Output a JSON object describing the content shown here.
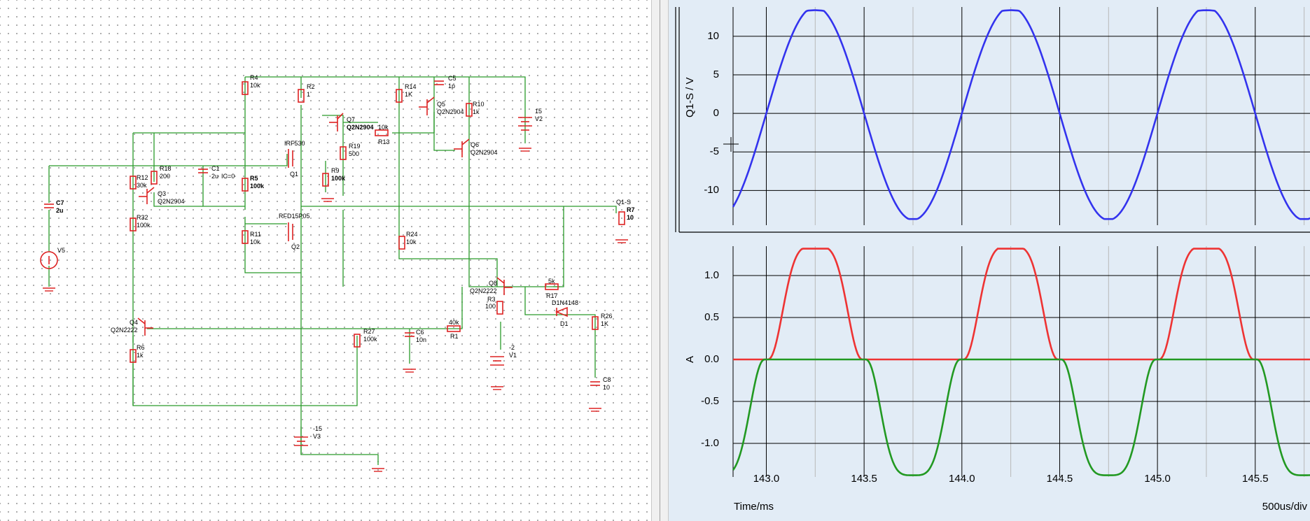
{
  "schematic": {
    "components": {
      "r4": {
        "ref": "R4",
        "value": "10k"
      },
      "r2": {
        "ref": "R2",
        "value": "1"
      },
      "r14": {
        "ref": "R14",
        "value": "1K"
      },
      "c5": {
        "ref": "C5",
        "value": "1p"
      },
      "r10": {
        "ref": "R10",
        "value": "1k"
      },
      "v2": {
        "ref": "V2",
        "value": "15"
      },
      "q7": {
        "ref": "Q7",
        "model": "Q2N2904"
      },
      "q5": {
        "ref": "Q5",
        "model": "Q2N2904"
      },
      "q6": {
        "ref": "Q6",
        "model": "Q2N2904"
      },
      "r13": {
        "ref": "R13",
        "value": "10k"
      },
      "r19": {
        "ref": "R19",
        "value": "500"
      },
      "r9": {
        "ref": "R9",
        "value": "100k"
      },
      "q1": {
        "ref": "Q1",
        "model": "IRF530"
      },
      "r18": {
        "ref": "R18",
        "value": "200"
      },
      "c1": {
        "ref": "C1",
        "value": "2u",
        "ic": "IC=0"
      },
      "r5": {
        "ref": "R5",
        "value": "100k"
      },
      "r12": {
        "ref": "R12",
        "value": "30k"
      },
      "q3": {
        "ref": "Q3",
        "model": "Q2N2904"
      },
      "c7": {
        "ref": "C7",
        "value": "2u"
      },
      "r32": {
        "ref": "R32",
        "value": "100k"
      },
      "q2": {
        "ref": "Q2",
        "model": "RFD15P05"
      },
      "r11": {
        "ref": "R11",
        "value": "10k"
      },
      "v5": {
        "ref": "V5"
      },
      "r24": {
        "ref": "R24",
        "value": "10k"
      },
      "r7": {
        "ref": "R7",
        "value": "10"
      },
      "probe": {
        "label": "Q1-S"
      },
      "q8": {
        "ref": "Q8",
        "model": "Q2N2222"
      },
      "r3": {
        "ref": "R3",
        "value": "100"
      },
      "r17": {
        "ref": "R17",
        "value": "5k"
      },
      "d1": {
        "ref": "D1",
        "model": "D1N4148"
      },
      "r26": {
        "ref": "R26",
        "value": "1K"
      },
      "c8": {
        "ref": "C8",
        "value": "10"
      },
      "q4": {
        "ref": "Q4",
        "model": "Q2N2222"
      },
      "r6": {
        "ref": "R6",
        "value": "1k"
      },
      "r27": {
        "ref": "R27",
        "value": "100k"
      },
      "c6": {
        "ref": "C6",
        "value": "10n"
      },
      "r1": {
        "ref": "R1",
        "value": "40k"
      },
      "v1": {
        "ref": "V1",
        "value": "-2"
      },
      "v3": {
        "ref": "V3",
        "value": "-15"
      }
    }
  },
  "scope": {
    "x_axis": {
      "label": "Time/ms",
      "scale": "500us/div",
      "ticks": [
        "143.0",
        "143.5",
        "144.0",
        "144.5",
        "145.0",
        "145.5"
      ]
    },
    "top_plot": {
      "ylabel": "Q1-S / V",
      "yticks": [
        "10",
        "5",
        "0",
        "-5",
        "-10"
      ]
    },
    "bottom_plot": {
      "ylabel": "A",
      "yticks": [
        "1.0",
        "0.5",
        "0.0",
        "-0.5",
        "-1.0"
      ]
    },
    "colors": {
      "voltage": "#3333ee",
      "current_pos": "#ee3333",
      "current_neg": "#229922",
      "background": "#e2ecf6"
    }
  },
  "chart_data": [
    {
      "type": "line",
      "ylabel": "Q1-S / V",
      "xlabel": "Time/ms",
      "xlim": [
        142.83,
        145.78
      ],
      "ylim": [
        -14.5,
        13.8
      ],
      "series": [
        {
          "kind": "sine",
          "amplitude": 13.3,
          "period_ms": 1.0,
          "zero_cross_rising_ms": 143.0,
          "flat_top": true
        }
      ]
    },
    {
      "type": "line",
      "ylabel": "A",
      "xlabel": "Time/ms",
      "xlim": [
        142.83,
        145.78
      ],
      "ylim": [
        -1.4,
        1.35
      ],
      "series": [
        {
          "kind": "half-wave-positive",
          "peak": 1.35,
          "period_ms": 1.0,
          "color": "#ee3333"
        },
        {
          "kind": "half-wave-negative",
          "peak": -1.38,
          "period_ms": 1.0,
          "color": "#229922"
        }
      ]
    }
  ]
}
